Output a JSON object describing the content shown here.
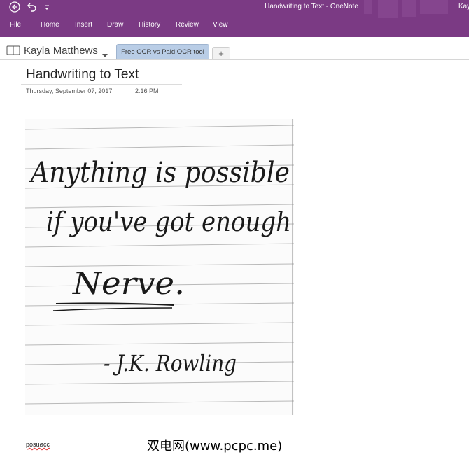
{
  "window": {
    "title": "Handwriting to Text  -  OneNote",
    "user": "Kayla Matthews",
    "accent_color": "#7b3a84"
  },
  "quick_access": {
    "back_icon": "back-arrow-icon",
    "undo_icon": "undo-icon",
    "customize_icon": "customize-toolbar-icon"
  },
  "ribbon": {
    "tabs": [
      "File",
      "Home",
      "Insert",
      "Draw",
      "History",
      "Review",
      "View"
    ]
  },
  "notebook": {
    "name": "Kayla Matthews",
    "icon": "notebook-icon",
    "section_tab": "Free OCR vs Paid OCR tool",
    "add_tab": "+"
  },
  "page": {
    "title": "Handwriting to Text",
    "date": "Thursday, September 07, 2017",
    "time": "2:16 PM",
    "image_handwriting": [
      "Anything is possible",
      "if you've got enough",
      "Nerve.",
      "- J.K. Rowling"
    ],
    "ocr_text": "posuøcc"
  },
  "watermark": "双电网(www.pcpc.me)"
}
